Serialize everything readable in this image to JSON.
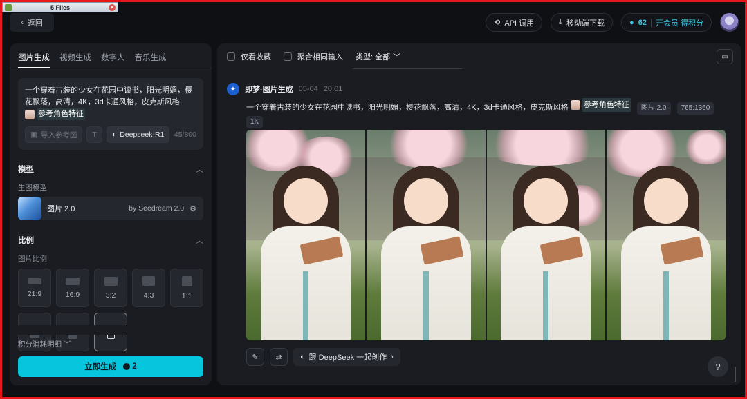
{
  "file_tab": {
    "label": "5 Files",
    "close": "×"
  },
  "topbar": {
    "back": "返回",
    "api": "API 调用",
    "mobile_download": "移动端下载",
    "points": "62",
    "vip": "开会员 得积分"
  },
  "left_panel": {
    "tabs": [
      "图片生成",
      "视频生成",
      "数字人",
      "音乐生成"
    ],
    "prompt": {
      "text": "一个穿着古装的少女在花园中读书，阳光明媚，樱花飘落，高清，4K，3d卡通风格，皮克斯风格",
      "ref_label": "参考角色特征",
      "import_ref": "导入参考图",
      "deepseek": "Deepseek-R1",
      "count": "45/800"
    },
    "model_section": {
      "title": "模型",
      "sub": "生图模型",
      "model_name": "图片 2.0",
      "model_by": "by Seedream 2.0"
    },
    "ratio_section": {
      "title": "比例",
      "sub": "图片比例",
      "ratios": [
        "21:9",
        "16:9",
        "3:2",
        "4:3",
        "1:1"
      ]
    },
    "cost_detail": "积分消耗明细",
    "generate": {
      "label": "立即生成",
      "cost": "2"
    }
  },
  "right_panel": {
    "filters": {
      "favorites": "仅看收藏",
      "merge": "聚合相同输入",
      "type": "类型: 全部"
    },
    "feed": {
      "source": "即梦-图片生成",
      "date": "05-04",
      "time": "20:01",
      "prompt": "一个穿着古装的少女在花园中读书，阳光明媚，樱花飘落，高清，4K，3d卡通风格，皮克斯风格",
      "ref_label": "参考角色特征",
      "tags": [
        "图片 2.0",
        "765:1360",
        "1K"
      ],
      "deepseek_button": "跟 DeepSeek 一起创作"
    },
    "help": "?"
  },
  "colors": {
    "accent": "#06c5dd",
    "frame": "#e8151b",
    "panel": "#1a1c22"
  },
  "icons": [
    "chevron-left-icon",
    "api-icon",
    "download-icon",
    "play-circle-icon",
    "folder-icon",
    "edit-icon",
    "refresh-icon",
    "deepseek-whale-icon",
    "chevron-up-icon",
    "chevron-down-icon",
    "settings-sliders-icon",
    "text-icon",
    "coin-icon"
  ]
}
